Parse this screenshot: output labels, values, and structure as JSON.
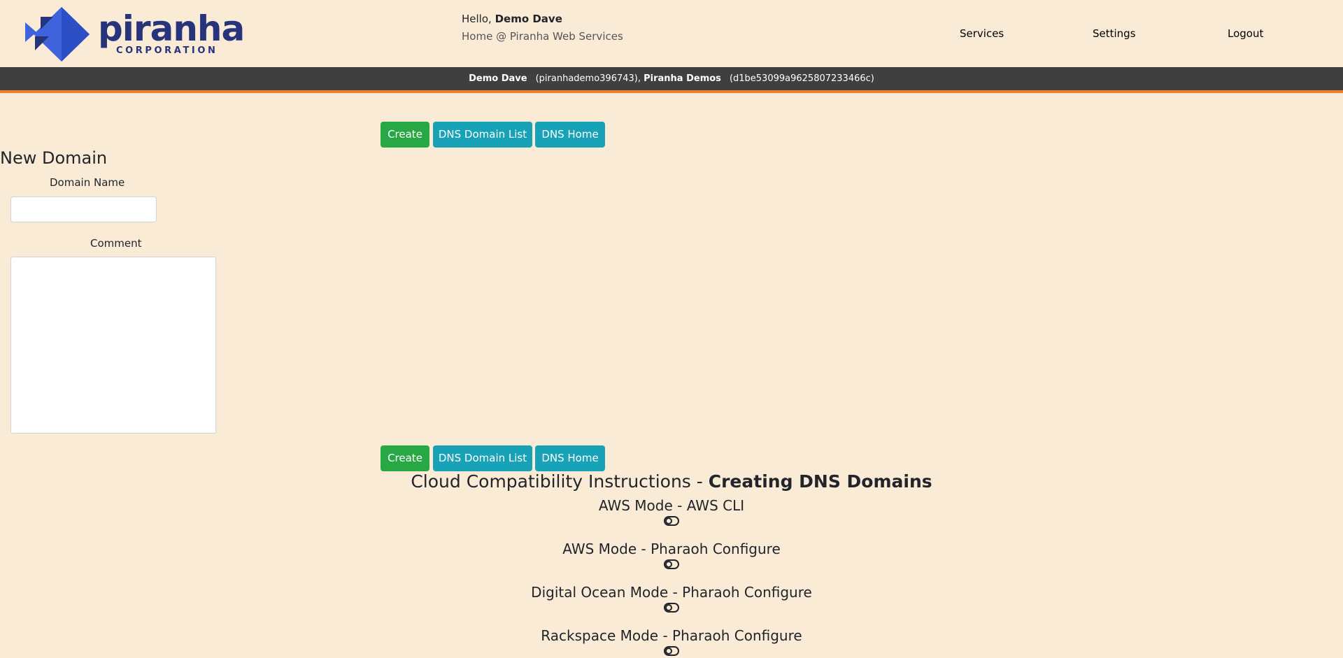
{
  "brand": {
    "name": "piranha",
    "tagline": "CORPORATION",
    "colors": {
      "primary": "#27337a",
      "diamond": "#3f63dd",
      "accent": "#ef7e24"
    }
  },
  "header": {
    "greeting_prefix": "Hello,",
    "user_name": "Demo Dave",
    "subtitle": "Home @ Piranha Web Services",
    "nav": [
      {
        "label": "Services"
      },
      {
        "label": "Settings"
      },
      {
        "label": "Logout"
      }
    ]
  },
  "account_bar": {
    "user_name": "Demo Dave",
    "user_id": "(piranhademo396743),",
    "org_name": "Piranha Demos",
    "org_id": "(d1be53099a9625807233466c)"
  },
  "toolbar": {
    "create_label": "Create",
    "list_label": "DNS Domain List",
    "home_label": "DNS Home"
  },
  "form": {
    "title": "New Domain",
    "domain_name_label": "Domain Name",
    "domain_name_value": "",
    "comment_label": "Comment",
    "comment_value": ""
  },
  "instructions": {
    "title_prefix": "Cloud Compatibility Instructions -",
    "title_bold": "Creating DNS Domains",
    "modes": [
      {
        "label": "AWS Mode - AWS CLI"
      },
      {
        "label": "AWS Mode - Pharaoh Configure"
      },
      {
        "label": "Digital Ocean Mode - Pharaoh Configure"
      },
      {
        "label": "Rackspace Mode - Pharaoh Configure"
      }
    ]
  }
}
